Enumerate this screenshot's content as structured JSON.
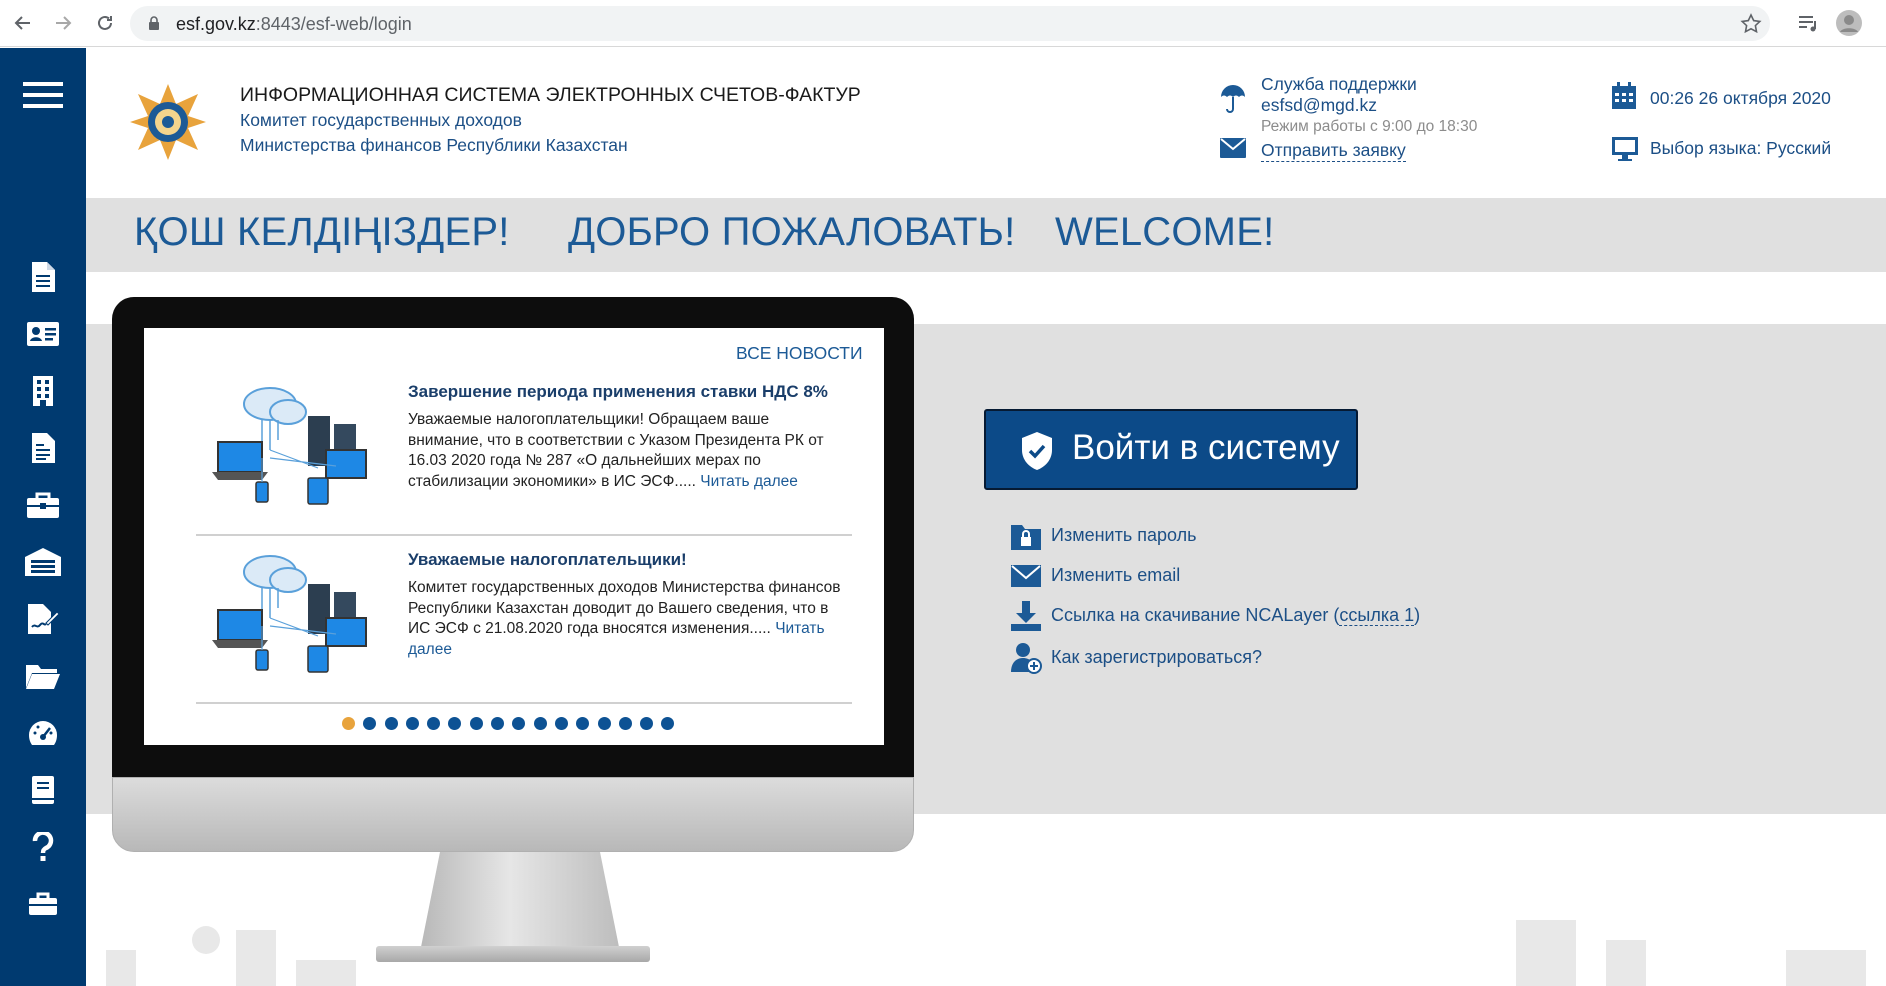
{
  "browser": {
    "url_host": "esf.gov.kz",
    "url_rest": ":8443/esf-web/login"
  },
  "sidebar": {
    "items": [
      {
        "icon": "document-icon"
      },
      {
        "icon": "id-card-icon"
      },
      {
        "icon": "building-icon"
      },
      {
        "icon": "invoice-icon"
      },
      {
        "icon": "briefcase-icon"
      },
      {
        "icon": "warehouse-icon"
      },
      {
        "icon": "signature-icon"
      },
      {
        "icon": "folder-icon"
      },
      {
        "icon": "dashboard-icon"
      },
      {
        "icon": "book-icon"
      },
      {
        "icon": "help-icon"
      },
      {
        "icon": "toolbox-icon"
      }
    ]
  },
  "header": {
    "title": "ИНФОРМАЦИОННАЯ СИСТЕМА ЭЛЕКТРОННЫХ СЧЕТОВ-ФАКТУР",
    "subtitle1": "Комитет государственных доходов",
    "subtitle2": "Министерства финансов Республики Казахстан",
    "support_label": "Служба поддержки",
    "support_email": "esfsd@mgd.kz",
    "support_hours": "Режим работы с 9:00 до 18:30",
    "support_request": "Отправить заявку",
    "datetime": "00:26 26 октября 2020",
    "language": "Выбор языка: Русский"
  },
  "welcome": {
    "kz": "ҚОШ КЕЛДІҢІЗДЕР!",
    "ru": "ДОБРО ПОЖАЛОВАТЬ!",
    "en": "WELCOME!"
  },
  "news": {
    "all_news": "ВСЕ НОВОСТИ",
    "items": [
      {
        "title": "Завершение периода применения ставки НДС 8%",
        "body": "Уважаемые налогоплательщики! Обращаем ваше внимание, что в соответствии с Указом Президента РК от 16.03 2020 года № 287 «О дальнейших мерах по стабилизации экономики» в ИС ЭСФ.....",
        "more": "Читать далее"
      },
      {
        "title": "Уважаемые налогоплательщики!",
        "body": "Комитет государственных доходов Министерства финансов Республики Казахстан доводит до Вашего сведения, что в ИС ЭСФ с 21.08.2020 года вносятся изменения.....",
        "more": "Читать далее"
      }
    ],
    "pages_total": 16,
    "active_page": 1
  },
  "login": {
    "button": "Войти в систему",
    "change_password": "Изменить пароль",
    "change_email": "Изменить email",
    "ncalayer": "Ссылка на скачивание NCALayer (",
    "ncalayer_link": "ссылка 1",
    "ncalayer_end": ")",
    "register": "Как зарегистрироваться?"
  },
  "colors": {
    "sidebar": "#003a70",
    "primary": "#1c4f86",
    "login_button": "#0c4a88",
    "band": "#e0e0e0",
    "active_dot": "#e8a33c"
  }
}
